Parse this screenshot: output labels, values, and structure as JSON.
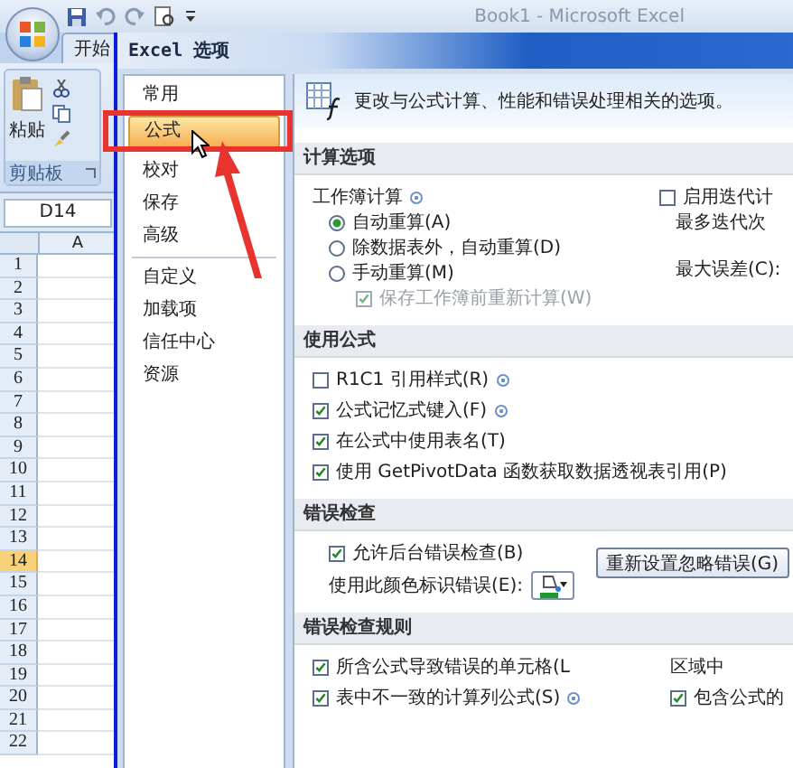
{
  "excel": {
    "title": "Book1 - Microsoft Excel",
    "ribbon_tab": "开始",
    "paste_label": "粘贴",
    "group_label": "剪贴板",
    "name_box": "D14",
    "column": "A",
    "rows": [
      {
        "label": "1",
        "selected": false
      },
      {
        "label": "2",
        "selected": false
      },
      {
        "label": "3",
        "selected": false
      },
      {
        "label": "4",
        "selected": false
      },
      {
        "label": "5",
        "selected": false
      },
      {
        "label": "6",
        "selected": false
      },
      {
        "label": "7",
        "selected": false
      },
      {
        "label": "8",
        "selected": false
      },
      {
        "label": "9",
        "selected": false
      },
      {
        "label": "10",
        "selected": false
      },
      {
        "label": "11",
        "selected": false
      },
      {
        "label": "12",
        "selected": false
      },
      {
        "label": "13",
        "selected": false
      },
      {
        "label": "14",
        "selected": true
      },
      {
        "label": "15",
        "selected": false
      },
      {
        "label": "16",
        "selected": false
      },
      {
        "label": "17",
        "selected": false
      },
      {
        "label": "18",
        "selected": false
      },
      {
        "label": "19",
        "selected": false
      },
      {
        "label": "20",
        "selected": false
      },
      {
        "label": "21",
        "selected": false
      },
      {
        "label": "22",
        "selected": false
      }
    ]
  },
  "dialog": {
    "title": "Excel 选项",
    "nav_groups": [
      [
        {
          "label": "常用",
          "selected": false
        },
        {
          "label": "公式",
          "selected": true
        },
        {
          "label": "校对",
          "selected": false
        },
        {
          "label": "保存",
          "selected": false
        },
        {
          "label": "高级",
          "selected": false
        }
      ],
      [
        {
          "label": "自定义",
          "selected": false
        },
        {
          "label": "加载项",
          "selected": false
        },
        {
          "label": "信任中心",
          "selected": false
        },
        {
          "label": "资源",
          "selected": false
        }
      ]
    ],
    "header": "更改与公式计算、性能和错误处理相关的选项。",
    "calculation": {
      "title": "计算选项",
      "workbook_label": "工作簿计算",
      "radios": [
        {
          "label": "自动重算(A)",
          "selected": true
        },
        {
          "label": "除数据表外，自动重算(D)",
          "selected": false
        },
        {
          "label": "手动重算(M)",
          "selected": false
        }
      ],
      "save_before": {
        "label": "保存工作簿前重新计算(W)",
        "checked": true,
        "disabled": true
      },
      "iterative": {
        "label": "启用迭代计",
        "checked": false
      },
      "max_iterations": "最多迭代次",
      "max_change": "最大误差(C):"
    },
    "formulas": {
      "title": "使用公式",
      "options": [
        {
          "label": "R1C1 引用样式(R)",
          "checked": false,
          "info": true
        },
        {
          "label": "公式记忆式键入(F)",
          "checked": true,
          "info": true
        },
        {
          "label": "在公式中使用表名(T)",
          "checked": true,
          "info": false
        },
        {
          "label": "使用 GetPivotData 函数获取数据透视表引用(P)",
          "checked": true,
          "info": false
        }
      ]
    },
    "error_checking": {
      "title": "错误检查",
      "background": {
        "label": "允许后台错误检查(B)",
        "checked": true
      },
      "color_label": "使用此颜色标识错误(E):",
      "reset_button": "重新设置忽略错误(G)"
    },
    "error_rules": {
      "title": "错误检查规则",
      "rows": [
        {
          "items": [
            {
              "kind": "check",
              "label": "所含公式导致错误的单元格(L",
              "checked": true,
              "info": false
            },
            {
              "kind": "text",
              "label": "区域中"
            }
          ]
        },
        {
          "items": [
            {
              "kind": "check",
              "label": "表中不一致的计算列公式(S)",
              "checked": true,
              "info": true
            },
            {
              "kind": "check",
              "label": "包含公式的",
              "checked": true,
              "info": false
            }
          ]
        }
      ]
    }
  }
}
